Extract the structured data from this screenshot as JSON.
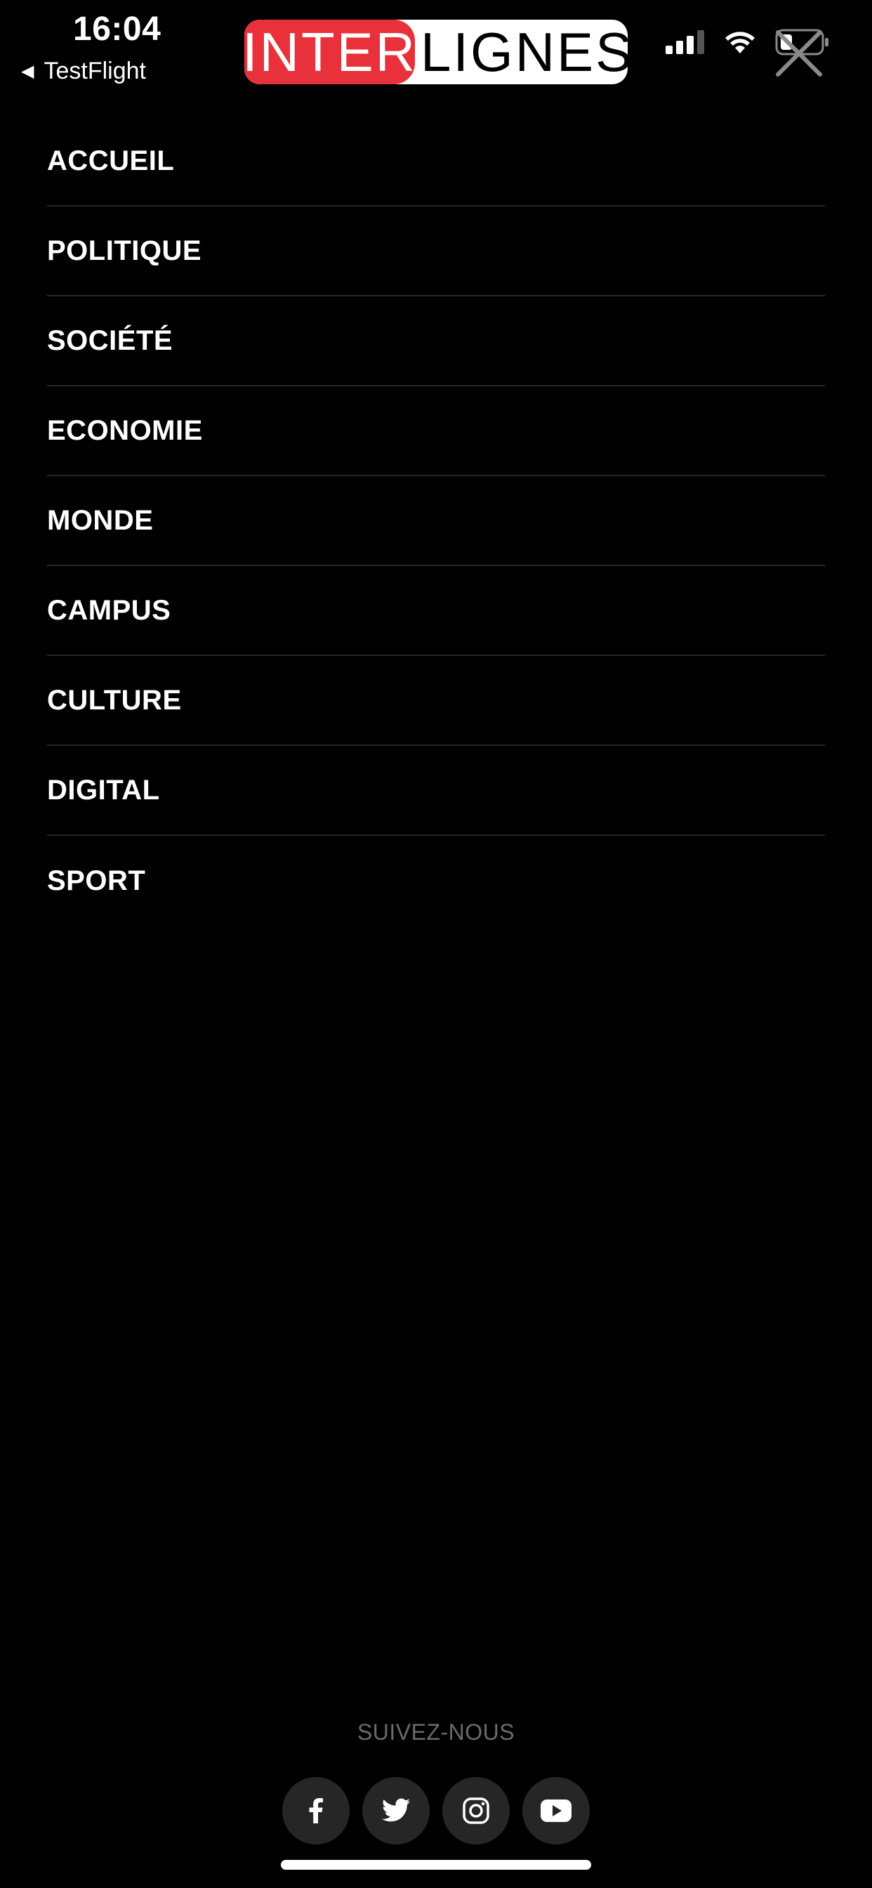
{
  "status_bar": {
    "time": "16:04",
    "back_label": "TestFlight"
  },
  "logo": {
    "part_left": "INTER",
    "part_right": "LIGNES",
    "brand_red": "#e8313a"
  },
  "menu": {
    "items": [
      {
        "label": "ACCUEIL"
      },
      {
        "label": "POLITIQUE"
      },
      {
        "label": "SOCIÉTÉ"
      },
      {
        "label": "ECONOMIE"
      },
      {
        "label": "MONDE"
      },
      {
        "label": "CAMPUS"
      },
      {
        "label": "CULTURE"
      },
      {
        "label": "DIGITAL"
      },
      {
        "label": "SPORT"
      }
    ]
  },
  "footer": {
    "follow_label": "SUIVEZ-NOUS",
    "social": [
      {
        "icon": "facebook-icon"
      },
      {
        "icon": "twitter-icon"
      },
      {
        "icon": "instagram-icon"
      },
      {
        "icon": "youtube-icon"
      }
    ]
  },
  "colors": {
    "background": "#000000",
    "divider": "#262626",
    "social_bg": "#262626",
    "muted_text": "#6b6b6b"
  }
}
